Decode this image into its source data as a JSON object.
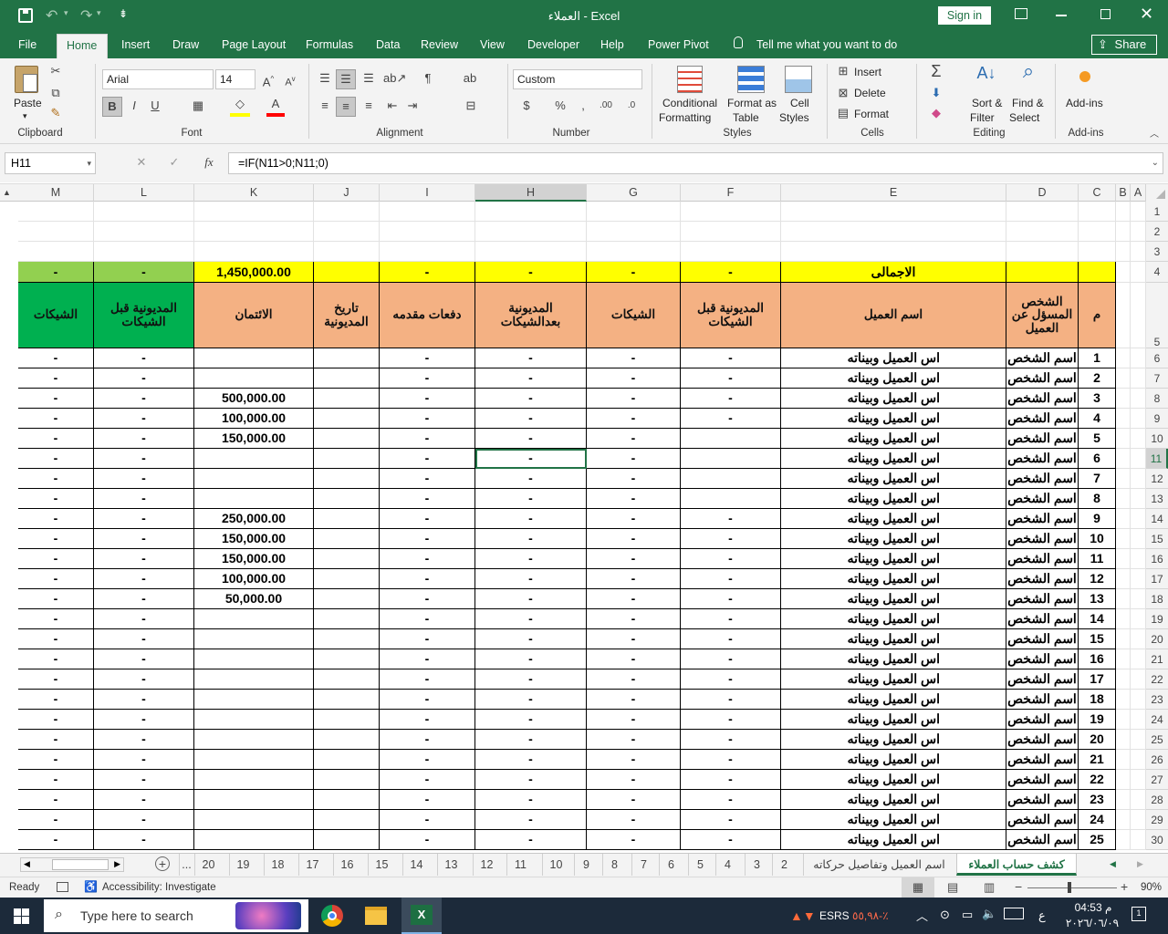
{
  "window": {
    "title": "العملاء  -  Excel",
    "signin": "Sign in",
    "colors": {
      "brand": "#217346",
      "orange": "#f4b183",
      "yellow": "#ffff00",
      "green": "#00b050",
      "olive": "#92d050"
    }
  },
  "ribbon_tabs": [
    "File",
    "Home",
    "Insert",
    "Draw",
    "Page Layout",
    "Formulas",
    "Data",
    "Review",
    "View",
    "Developer",
    "Help",
    "Power Pivot"
  ],
  "tell_me": "Tell me what you want to do",
  "share": "Share",
  "ribbon": {
    "paste": "Paste",
    "clipboard": "Clipboard",
    "font_name": "Arial",
    "font_size": "14",
    "font": "Font",
    "alignment": "Alignment",
    "number_format": "Custom",
    "number": "Number",
    "conditional": "Conditional",
    "formatting": "Formatting",
    "format_as": "Format as",
    "table": "Table",
    "cell": "Cell",
    "styles_btn": "Styles",
    "styles": "Styles",
    "insert": "Insert",
    "delete": "Delete",
    "format": "Format",
    "cells": "Cells",
    "sort": "Sort &",
    "filter": "Filter",
    "find": "Find &",
    "select": "Select",
    "editing": "Editing",
    "addins": "Add-ins",
    "addins_group": "Add-ins",
    "bold": "B",
    "italic": "I",
    "underline": "U",
    "percent": "%"
  },
  "formula_bar": {
    "name_box": "H11",
    "fx": "fx",
    "formula": "=IF(N11>0;N11;0)"
  },
  "columns": [
    "M",
    "L",
    "K",
    "J",
    "I",
    "H",
    "G",
    "F",
    "E",
    "D",
    "C",
    "B",
    "A"
  ],
  "row_numbers": [
    "1",
    "2",
    "3",
    "4",
    "5",
    "6",
    "7",
    "8",
    "9",
    "10",
    "11",
    "12",
    "13",
    "14",
    "15",
    "16",
    "17",
    "18",
    "19",
    "20",
    "21",
    "22",
    "23",
    "24",
    "25",
    "26",
    "27",
    "28",
    "29",
    "30"
  ],
  "totals_row": {
    "label": "الاجمالى",
    "M": "-",
    "L": "-",
    "K": "1,450,000.00",
    "J": "",
    "I": "-",
    "H": "-",
    "G": "-",
    "F": "-"
  },
  "headers": {
    "M": "الشيكات",
    "L": "المديونية قبل الشيكات",
    "K": "الائتمان",
    "J": "تاريخ المديونية",
    "I": "دفعات مقدمه",
    "H": "المديونية بعدالشيكات",
    "G": "الشيكات",
    "F": "المديونية قبل الشيكات",
    "E": "اسم العميل",
    "D": "الشخص المسؤل عن العميل",
    "C": "م"
  },
  "data_rows": [
    {
      "n": "1",
      "credit": "",
      "f": "-"
    },
    {
      "n": "2",
      "credit": "",
      "f": "-"
    },
    {
      "n": "3",
      "credit": "500,000.00",
      "f": "-"
    },
    {
      "n": "4",
      "credit": "100,000.00",
      "f": "-"
    },
    {
      "n": "5",
      "credit": "150,000.00",
      "f": ""
    },
    {
      "n": "6",
      "credit": "",
      "f": ""
    },
    {
      "n": "7",
      "credit": "",
      "f": ""
    },
    {
      "n": "8",
      "credit": "",
      "f": ""
    },
    {
      "n": "9",
      "credit": "250,000.00",
      "f": "-"
    },
    {
      "n": "10",
      "credit": "150,000.00",
      "f": "-"
    },
    {
      "n": "11",
      "credit": "150,000.00",
      "f": "-"
    },
    {
      "n": "12",
      "credit": "100,000.00",
      "f": "-"
    },
    {
      "n": "13",
      "credit": "50,000.00",
      "f": "-"
    },
    {
      "n": "14",
      "credit": "",
      "f": "-"
    },
    {
      "n": "15",
      "credit": "",
      "f": "-"
    },
    {
      "n": "16",
      "credit": "",
      "f": "-"
    },
    {
      "n": "17",
      "credit": "",
      "f": "-"
    },
    {
      "n": "18",
      "credit": "",
      "f": "-"
    },
    {
      "n": "19",
      "credit": "",
      "f": "-"
    },
    {
      "n": "20",
      "credit": "",
      "f": "-"
    },
    {
      "n": "21",
      "credit": "",
      "f": "-"
    },
    {
      "n": "22",
      "credit": "",
      "f": "-"
    },
    {
      "n": "23",
      "credit": "",
      "f": "-"
    },
    {
      "n": "24",
      "credit": "",
      "f": "-"
    },
    {
      "n": "25",
      "credit": "",
      "f": "-"
    }
  ],
  "row_text": {
    "customer": "اس العميل وبيناته",
    "person": "اسم الشخص",
    "dash": "-"
  },
  "sheet_tabs": [
    "كشف حساب العملاء",
    "اسم العميل وتفاصيل حركاته",
    "2",
    "3",
    "4",
    "5",
    "6",
    "7",
    "8",
    "9",
    "10",
    "11",
    "12",
    "13",
    "14",
    "15",
    "16",
    "17",
    "18",
    "19",
    "20",
    "..."
  ],
  "status": {
    "ready": "Ready",
    "accessibility": "Accessibility: Investigate",
    "zoom": "90%"
  },
  "taskbar": {
    "search": "Type here to search",
    "ticker": "ESRS",
    "ticker_change": "٥٥,٩٨-٪",
    "time": "04:53 م",
    "date": "٢٠٢٦/٠٦/٠٩",
    "lang": "ع"
  }
}
